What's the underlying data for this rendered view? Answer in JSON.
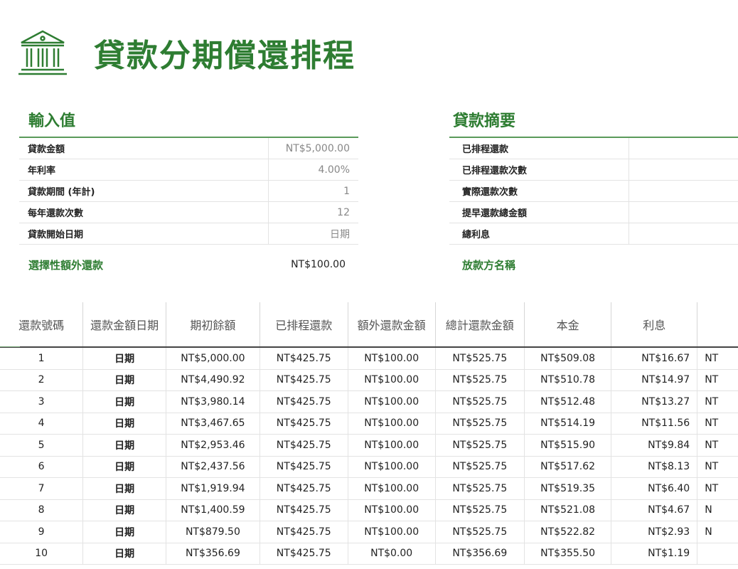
{
  "title": "貸款分期償還排程",
  "icon": "bank-icon",
  "inputs": {
    "heading": "輸入值",
    "rows": [
      {
        "label": "貸款金額",
        "value": "NT$5,000.00"
      },
      {
        "label": "年利率",
        "value": "4.00%"
      },
      {
        "label": "貸款期間 (年計)",
        "value": "1"
      },
      {
        "label": "每年還款次數",
        "value": "12"
      },
      {
        "label": "貸款開始日期",
        "value": "日期"
      }
    ],
    "extra_label": "選擇性額外還款",
    "extra_value": "NT$100.00"
  },
  "summary": {
    "heading": "貸款摘要",
    "rows": [
      {
        "label": "已排程還款",
        "value": ""
      },
      {
        "label": "已排程還款次數",
        "value": ""
      },
      {
        "label": "實際還款次數",
        "value": ""
      },
      {
        "label": "提早還款總金額",
        "value": ""
      },
      {
        "label": "總利息",
        "value": ""
      }
    ],
    "lender_label": "放款方名稱"
  },
  "schedule": {
    "columns": [
      "還款號碼",
      "還款金額日期",
      "期初餘額",
      "已排程還款",
      "額外還款金額",
      "總計還款金額",
      "本金",
      "利息",
      ""
    ],
    "rows": [
      [
        "1",
        "日期",
        "NT$5,000.00",
        "NT$425.75",
        "NT$100.00",
        "NT$525.75",
        "NT$509.08",
        "NT$16.67",
        "NT"
      ],
      [
        "2",
        "日期",
        "NT$4,490.92",
        "NT$425.75",
        "NT$100.00",
        "NT$525.75",
        "NT$510.78",
        "NT$14.97",
        "NT"
      ],
      [
        "3",
        "日期",
        "NT$3,980.14",
        "NT$425.75",
        "NT$100.00",
        "NT$525.75",
        "NT$512.48",
        "NT$13.27",
        "NT"
      ],
      [
        "4",
        "日期",
        "NT$3,467.65",
        "NT$425.75",
        "NT$100.00",
        "NT$525.75",
        "NT$514.19",
        "NT$11.56",
        "NT"
      ],
      [
        "5",
        "日期",
        "NT$2,953.46",
        "NT$425.75",
        "NT$100.00",
        "NT$525.75",
        "NT$515.90",
        "NT$9.84",
        "NT"
      ],
      [
        "6",
        "日期",
        "NT$2,437.56",
        "NT$425.75",
        "NT$100.00",
        "NT$525.75",
        "NT$517.62",
        "NT$8.13",
        "NT"
      ],
      [
        "7",
        "日期",
        "NT$1,919.94",
        "NT$425.75",
        "NT$100.00",
        "NT$525.75",
        "NT$519.35",
        "NT$6.40",
        "NT"
      ],
      [
        "8",
        "日期",
        "NT$1,400.59",
        "NT$425.75",
        "NT$100.00",
        "NT$525.75",
        "NT$521.08",
        "NT$4.67",
        "N"
      ],
      [
        "9",
        "日期",
        "NT$879.50",
        "NT$425.75",
        "NT$100.00",
        "NT$525.75",
        "NT$522.82",
        "NT$2.93",
        "N"
      ],
      [
        "10",
        "日期",
        "NT$356.69",
        "NT$425.75",
        "NT$0.00",
        "NT$356.69",
        "NT$355.50",
        "NT$1.19",
        ""
      ]
    ]
  },
  "colors": {
    "accent": "#2e7d32"
  }
}
